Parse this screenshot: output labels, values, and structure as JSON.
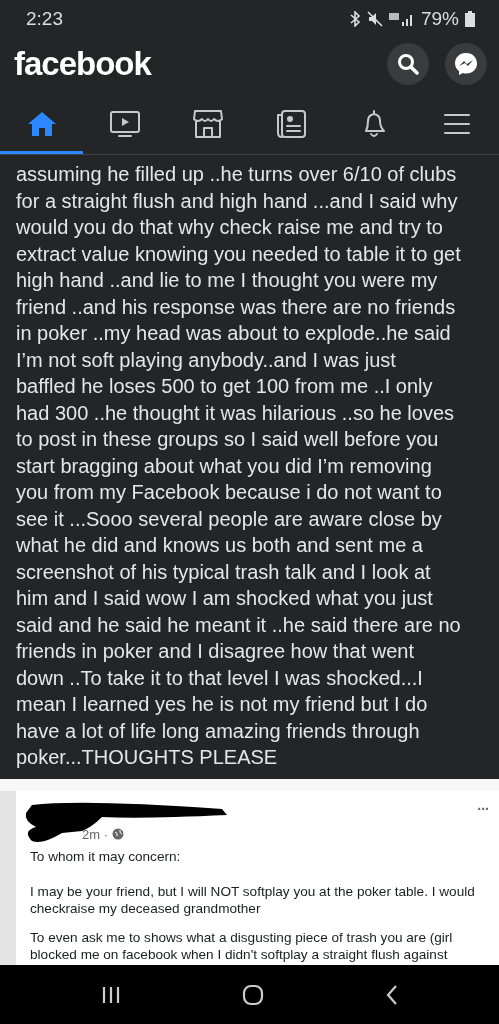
{
  "status_bar": {
    "time": "2:23",
    "battery": "79%"
  },
  "header": {
    "logo": "facebook"
  },
  "nav_tabs": [
    {
      "kind": "home",
      "selected": true
    },
    {
      "kind": "watch",
      "selected": false
    },
    {
      "kind": "marketplace",
      "selected": false
    },
    {
      "kind": "news",
      "selected": false
    },
    {
      "kind": "notifications",
      "selected": false
    },
    {
      "kind": "menu",
      "selected": false
    }
  ],
  "post": {
    "text": "assuming he filled up ..he turns over 6/10 of clubs\nfor a straight flush and high hand ...and I said why\nwould you do that why check raise me and try to\nextract value knowing you needed to table it to get\nhigh hand ..and lie to me I thought you were my\nfriend ..and his response was there are no friends\nin poker ..my head was about to explode..he said\nI’m not soft playing anybody..and I was just\nbaffled he loses 500 to get 100 from me ..I only\nhad 300 ..he thought it was hilarious ..so he loves\nto post in these groups so I said well before you\nstart bragging about what you did I’m removing\nyou from my Facebook because i do not want to\nsee it ...Sooo several people are aware close by\nwhat he did and knows us both and sent me a\nscreenshot of his typical trash talk and I look at\nhim and I said wow I am shocked what you just\nsaid and he said he meant it ..he said there are no\nfriends in poker and I disagree how that went\ndown ..To take it to that level I was shocked...I\nmean I learned yes he is not my friend but I do\nhave a lot of life long amazing friends through\npoker...THOUGHTS PLEASE"
  },
  "screenshot": {
    "time": "2m ·",
    "more": "...",
    "paragraphs": [
      "To whom it may concern:",
      "I may be your friend, but I will NOT softplay you at  the poker table.  I would checkraise my deceased grandmother",
      "To even ask me to shows what a disgusting piece of trash you are (girl blocked me on facebook when I didn't softplay a straight flush against"
    ]
  }
}
